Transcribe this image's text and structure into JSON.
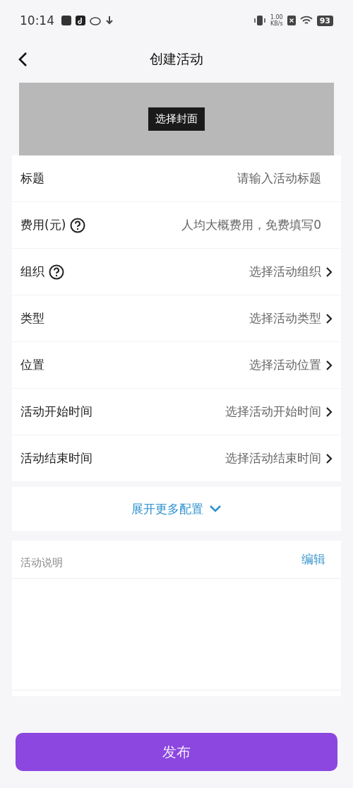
{
  "status_bar": {
    "time": "10:14",
    "network_speed_value": "1.00",
    "network_speed_unit": "KB/s",
    "battery": "93"
  },
  "nav": {
    "title": "创建活动"
  },
  "cover": {
    "button": "选择封面"
  },
  "fields": [
    {
      "label": "标题",
      "kind": "input",
      "help": false,
      "placeholder": "请输入活动标题"
    },
    {
      "label": "费用(元)",
      "kind": "input",
      "help": true,
      "placeholder": "人均大概费用，免费填写0"
    },
    {
      "label": "组织",
      "kind": "select",
      "help": true,
      "placeholder": "选择活动组织"
    },
    {
      "label": "类型",
      "kind": "select",
      "help": false,
      "placeholder": "选择活动类型"
    },
    {
      "label": "位置",
      "kind": "select",
      "help": false,
      "placeholder": "选择活动位置"
    },
    {
      "label": "活动开始时间",
      "kind": "select",
      "help": false,
      "placeholder": "选择活动开始时间"
    },
    {
      "label": "活动结束时间",
      "kind": "select",
      "help": false,
      "placeholder": "选择活动结束时间"
    }
  ],
  "expand": {
    "label": "展开更多配置",
    "expanded": false
  },
  "description": {
    "label": "活动说明",
    "edit": "编辑"
  },
  "submit": {
    "label": "发布"
  }
}
